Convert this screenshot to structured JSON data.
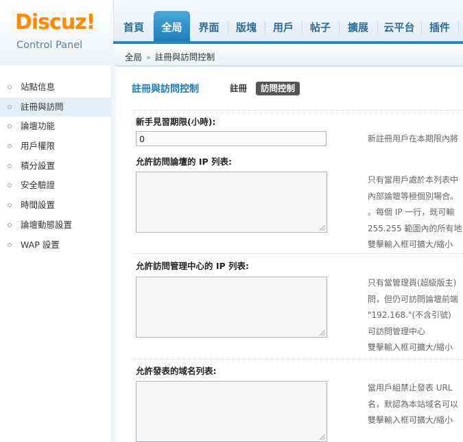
{
  "brand": {
    "logo_text": "Discuz!",
    "logo_sub": "Control Panel"
  },
  "nav": {
    "items": [
      {
        "label": "首頁"
      },
      {
        "label": "全局"
      },
      {
        "label": "界面"
      },
      {
        "label": "版塊"
      },
      {
        "label": "用戶"
      },
      {
        "label": "帖子"
      },
      {
        "label": "擴展"
      },
      {
        "label": "云平台"
      },
      {
        "label": "插件"
      }
    ],
    "active": "全局"
  },
  "breadcrumb": {
    "root": "全局",
    "separator": "»",
    "current": "註冊與訪問控制"
  },
  "sidebar": {
    "items": [
      {
        "label": "站點信息"
      },
      {
        "label": "註冊與訪問"
      },
      {
        "label": "論壇功能"
      },
      {
        "label": "用戶權限"
      },
      {
        "label": "積分設置"
      },
      {
        "label": "安全驗證"
      },
      {
        "label": "時間設置"
      },
      {
        "label": "論壇動態設置"
      },
      {
        "label": "WAP 設置"
      }
    ],
    "active": "註冊與訪問"
  },
  "main": {
    "title": "註冊與訪問控制",
    "subtabs": [
      {
        "label": "註冊"
      },
      {
        "label": "訪問控制"
      }
    ],
    "active_subtab": "訪問控制",
    "fields": [
      {
        "label": "新手見習期限(小時):",
        "value": "0",
        "help": [
          "新註冊用戶在本期限內將"
        ]
      },
      {
        "label": "允許訪問論壇的 IP 列表:",
        "value": "",
        "help": [
          "只有當用戶處於本列表中",
          "內部論壇等極個別場合。",
          "。每個 IP 一行，既可輸",
          "255.255 範圍內的所有地",
          "雙擊輸入框可擴大/縮小"
        ]
      },
      {
        "label": "允許訪問管理中心的 IP 列表:",
        "value": "",
        "help": [
          "只有當管理員(超級版主)",
          "問，但仍可訪問論壇前端",
          "\"192.168.\"(不含引號)",
          "可訪問管理中心",
          "雙擊輸入框可擴大/縮小"
        ]
      },
      {
        "label": "允許發表的域名列表:",
        "value": "",
        "help": [
          "當用戶組禁止發表 URL",
          "名，默認為本站域名可以",
          "雙擊輸入框可擴大/縮小"
        ]
      }
    ]
  }
}
